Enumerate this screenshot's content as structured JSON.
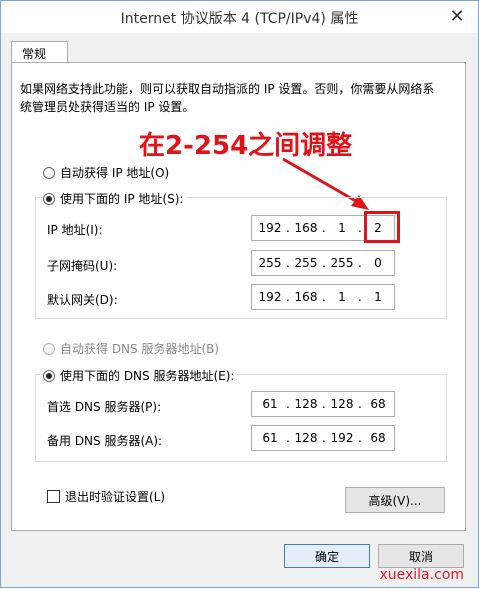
{
  "window": {
    "title": "Internet 协议版本 4 (TCP/IPv4) 属性",
    "close_glyph": "✕"
  },
  "tabs": [
    {
      "label": "常规"
    }
  ],
  "description": "如果网络支持此功能，则可以获取自动指派的 IP 设置。否则，你需要从网络系统管理员处获得适当的 IP 设置。",
  "annotation": {
    "text": "在2-254之间调整",
    "color": "#e0121a"
  },
  "ip_section": {
    "auto_label": "自动获得 IP 地址(O)",
    "manual_label": "使用下面的 IP 地址(S):",
    "selected": "manual",
    "fields": [
      {
        "label": "IP 地址(I):",
        "octets": [
          "192",
          "168",
          "1",
          "2"
        ]
      },
      {
        "label": "子网掩码(U):",
        "octets": [
          "255",
          "255",
          "255",
          "0"
        ]
      },
      {
        "label": "默认网关(D):",
        "octets": [
          "192",
          "168",
          "1",
          "1"
        ]
      }
    ]
  },
  "dns_section": {
    "auto_label": "自动获得 DNS 服务器地址(B)",
    "manual_label": "使用下面的 DNS 服务器地址(E):",
    "selected": "manual",
    "fields": [
      {
        "label": "首选 DNS 服务器(P):",
        "octets": [
          "61",
          "128",
          "128",
          "68"
        ]
      },
      {
        "label": "备用 DNS 服务器(A):",
        "octets": [
          "61",
          "128",
          "192",
          "68"
        ]
      }
    ]
  },
  "validate_label": "退出时验证设置(L)",
  "validate_checked": false,
  "advanced_label": "高级(V)...",
  "ok_label": "确定",
  "cancel_label": "取消",
  "watermark": "xuexila.com",
  "colors": {
    "accent_red": "#e0121a",
    "border_blue": "#7aa7d8"
  }
}
